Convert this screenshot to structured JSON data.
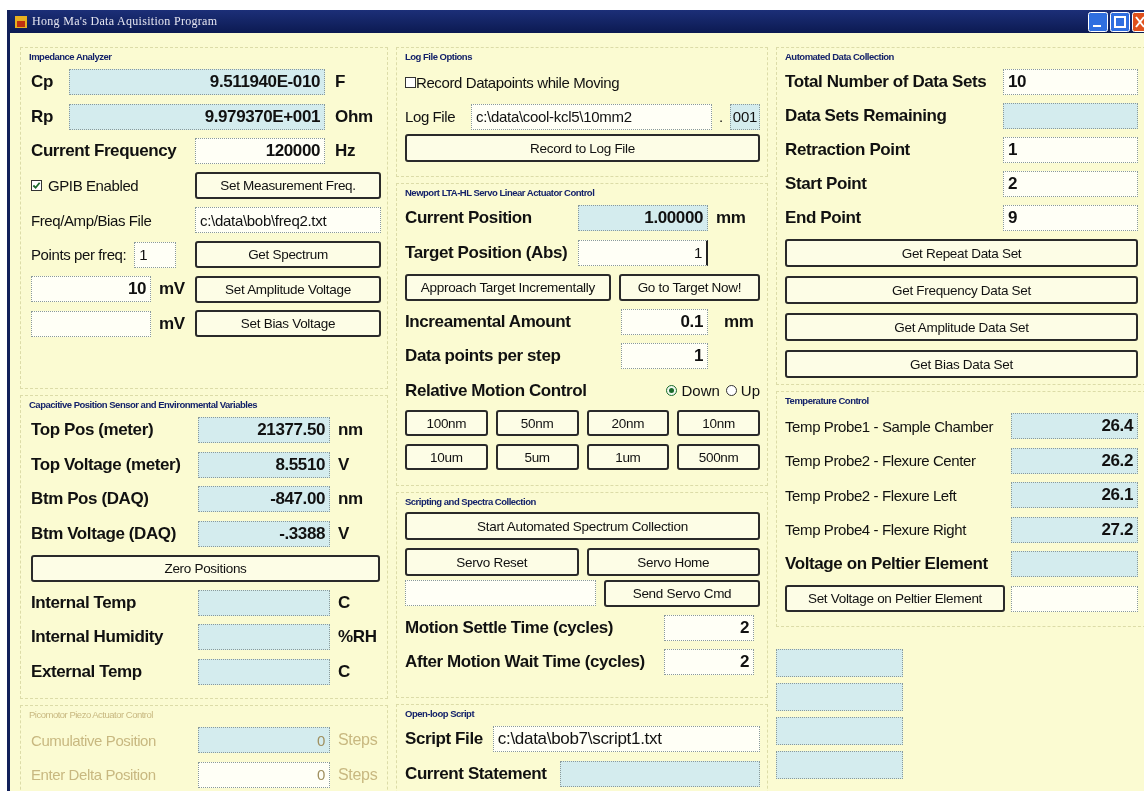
{
  "window": {
    "title": "Hong Ma's Data Aquisition Program"
  },
  "impedance_analyzer": {
    "title": "Impedance Analyzer",
    "readouts": [
      {
        "label": "Cp",
        "value": "9.511940E-010",
        "unit": "F",
        "readonly": true
      },
      {
        "label": "Rp",
        "value": "9.979370E+001",
        "unit": "Ohm",
        "readonly": true
      }
    ],
    "frequency": {
      "label": "Current Frequency",
      "value": "120000",
      "unit": "Hz",
      "readonly": false
    },
    "gpib": {
      "label": "GPIB Enabled",
      "checked": true
    },
    "set_freq_button": "Set Measurement Freq.",
    "file": {
      "label": "Freq/Amp/Bias File",
      "value": "c:\\data\\bob\\freq2.txt",
      "readonly": false
    },
    "points": {
      "label": "Points per freq:",
      "value": "1",
      "readonly": false
    },
    "spectrum_button": "Get Spectrum",
    "voltages": [
      {
        "value": "10",
        "unit": "mV",
        "button": "Set Amplitude Voltage",
        "readonly": false
      },
      {
        "unit": "mV",
        "button": "Set Bias Voltage",
        "readonly": false
      }
    ]
  },
  "capacitive_sensor": {
    "title": "Capacitive Position Sensor and Environmental Variables",
    "readings": [
      {
        "label": "Top Pos (meter)",
        "value": "21377.50",
        "unit": "nm",
        "readonly": true
      },
      {
        "label": "Top Voltage (meter)",
        "value": "8.5510",
        "unit": "V",
        "readonly": true
      },
      {
        "label": "Btm Pos (DAQ)",
        "value": "-847.00",
        "unit": "nm",
        "readonly": true
      },
      {
        "label": "Btm Voltage (DAQ)",
        "value": "-.3388",
        "unit": "V",
        "readonly": true
      }
    ],
    "zero_button": "Zero Positions",
    "environment": [
      {
        "label": "Internal Temp",
        "unit": "C",
        "readonly": true
      },
      {
        "label": "Internal Humidity",
        "unit": "%RH",
        "readonly": true
      },
      {
        "label": "External Temp",
        "unit": "C",
        "readonly": true
      }
    ]
  },
  "picomotor": {
    "title": "Picomotor Piezo Actuator Control",
    "disabled": true,
    "rows": [
      {
        "label": "Cumulative Position",
        "value": "0",
        "unit": "Steps",
        "readonly": true
      },
      {
        "label": "Enter Delta Position",
        "value": "0",
        "unit": "Steps",
        "readonly": false
      }
    ]
  },
  "log_file_options": {
    "title": "Log File Options",
    "record_while_moving": {
      "label": "Record Datapoints while Moving",
      "checked": false
    },
    "log_file": {
      "label": "Log File",
      "value": "c:\\data\\cool-kcl5\\10mm2",
      "readonly": false,
      "separator": ".",
      "index": "001",
      "index_readonly": true
    },
    "record_button": "Record to Log File"
  },
  "servo": {
    "title": "Newport LTA-HL Servo Linear Actuator Control",
    "current": {
      "label": "Current Position",
      "value": "1.00000",
      "unit": "mm",
      "readonly": true
    },
    "target": {
      "label": "Target Position (Abs)",
      "value": "1",
      "readonly": false
    },
    "buttons": [
      "Approach Target Incrementally",
      "Go to Target Now!"
    ],
    "increment": {
      "label": "Increamental Amount",
      "value": "0.1",
      "unit": "mm",
      "readonly": false
    },
    "points_per_step": {
      "label": "Data points per step",
      "value": "1",
      "readonly": false
    },
    "relative": {
      "label": "Relative Motion Control",
      "directions": [
        {
          "label": "Down",
          "selected": true
        },
        {
          "label": "Up",
          "selected": false
        }
      ]
    },
    "steps": [
      "100nm",
      "50nm",
      "20nm",
      "10nm",
      "10um",
      "5um",
      "1um",
      "500nm"
    ]
  },
  "scripting": {
    "title": "Scripting and Spectra Collection",
    "start_button": "Start Automated Spectrum Collection",
    "buttons": [
      "Servo Reset",
      "Servo Home"
    ],
    "command": {
      "readonly": false
    },
    "send_button": "Send Servo Cmd",
    "times": [
      {
        "label": "Motion Settle Time (cycles)",
        "value": "2",
        "readonly": false
      },
      {
        "label": "After Motion Wait Time (cycles)",
        "value": "2",
        "readonly": false
      }
    ]
  },
  "open_loop_script": {
    "title": "Open-loop Script",
    "script_file": {
      "label": "Script File",
      "value": "c:\\data\\bob7\\script1.txt",
      "readonly": false
    },
    "current_statement": {
      "label": "Current Statement",
      "readonly": true
    }
  },
  "automated_data_collection": {
    "title": "Automated Data Collection",
    "fields": [
      {
        "label": "Total Number of Data Sets",
        "value": "10",
        "readonly": false
      },
      {
        "label": "Data Sets Remaining",
        "readonly": true
      },
      {
        "label": "Retraction Point",
        "value": "1",
        "readonly": false
      },
      {
        "label": "Start Point",
        "value": "2",
        "readonly": false
      },
      {
        "label": "End Point",
        "value": "9",
        "readonly": false
      }
    ],
    "buttons": [
      "Get Repeat Data Set",
      "Get Frequency Data Set",
      "Get Amplitude Data Set",
      "Get Bias Data Set"
    ]
  },
  "temperature_control": {
    "title": "Temperature Control",
    "probes": [
      {
        "label": "Temp Probe1 - Sample Chamber",
        "value": "26.4",
        "readonly": true
      },
      {
        "label": "Temp Probe2 - Flexure Center",
        "value": "26.2",
        "readonly": true
      },
      {
        "label": "Temp Probe2 - Flexure Left",
        "value": "26.1",
        "readonly": true
      },
      {
        "label": "Temp Probe4 - Flexure Right",
        "value": "27.2",
        "readonly": true
      }
    ],
    "peltier": {
      "label": "Voltage on Peltier Element",
      "readonly": true
    },
    "peltier_button": "Set Voltage on Peltier Element",
    "peltier_input": {
      "readonly": false
    }
  },
  "extra_readouts": [
    {
      "readonly": true
    },
    {
      "readonly": true
    },
    {
      "readonly": true
    },
    {
      "readonly": true
    }
  ]
}
